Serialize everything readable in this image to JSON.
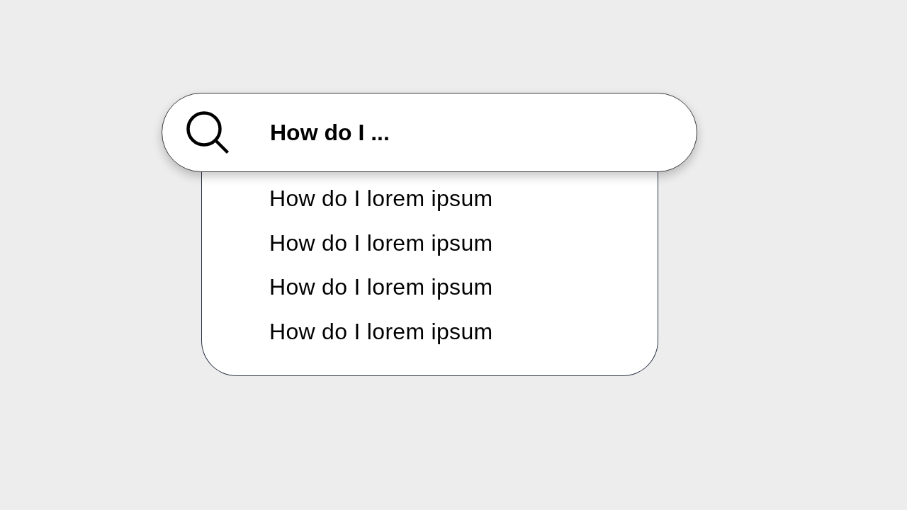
{
  "search": {
    "value": "How do I ..."
  },
  "suggestions": [
    "How do I lorem ipsum",
    "How do I lorem ipsum",
    "How do I lorem ipsum",
    "How do I lorem ipsum"
  ]
}
